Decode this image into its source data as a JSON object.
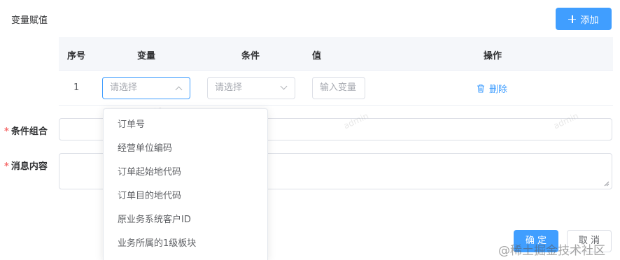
{
  "header": {
    "title": "变量赋值",
    "add_label": "添加"
  },
  "table": {
    "columns": [
      "序号",
      "变量",
      "条件",
      "值",
      "操作"
    ],
    "row": {
      "index": "1",
      "variable_placeholder": "请选择",
      "condition_placeholder": "请选择",
      "value_placeholder": "输入变量",
      "delete_label": "删除"
    }
  },
  "form": {
    "condition_group_label": "条件组合",
    "message_label": "消息内容",
    "required_mark": "*"
  },
  "dropdown": {
    "options": [
      "订单号",
      "经营单位编码",
      "订单起始地代码",
      "订单目的地代码",
      "原业务系统客户ID",
      "业务所属的1级板块"
    ]
  },
  "footer": {
    "ok_label": "确 定",
    "cancel_label": "取 消"
  },
  "watermark": {
    "text": "admin",
    "brand": "@稀土掘金技术社区"
  },
  "colors": {
    "primary": "#409eff",
    "danger": "#f56c6c",
    "border": "#dcdfe6"
  },
  "icons": {
    "add": "plus-icon",
    "delete": "trash-icon",
    "select_open": "chevron-up-icon",
    "select_closed": "chevron-down-icon"
  }
}
